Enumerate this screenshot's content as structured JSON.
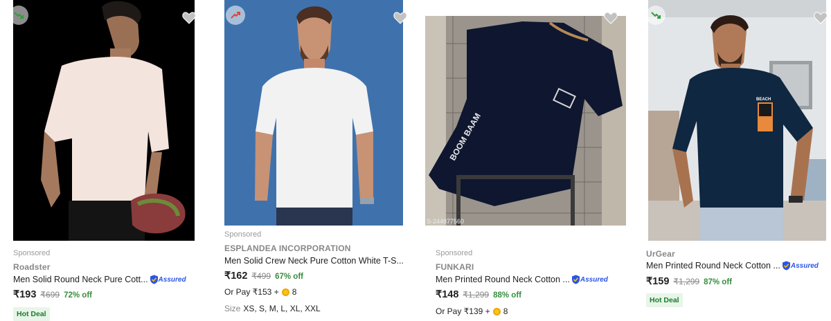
{
  "products": [
    {
      "sponsored": "Sponsored",
      "brand": "Roadster",
      "title": "Men Solid Round Neck Pure Cott...",
      "assured": "Assured",
      "price": "₹193",
      "mrp": "₹699",
      "off": "72% off",
      "badge": "Hot Deal",
      "trend_icon": "trend-down-icon"
    },
    {
      "sponsored": "Sponsored",
      "brand": "ESPLANDEA INCORPORATION",
      "title": "Men Solid Crew Neck Pure Cotton White T-S...",
      "price": "₹162",
      "mrp": "₹499",
      "off": "67% off",
      "pay_prefix": "Or Pay ₹153 +",
      "pay_coins": "8",
      "size_label": "Size",
      "sizes": "XS, S, M, L, XL, XXL",
      "trend_icon": "trend-up-icon"
    },
    {
      "sponsored": "Sponsored",
      "brand": "FUNKARI",
      "title": "Men Printed Round Neck Cotton ...",
      "assured": "Assured",
      "price": "₹148",
      "mrp": "₹1,299",
      "off": "88% off",
      "pay_prefix": "Or Pay ₹139 +",
      "pay_coins": "8",
      "image_text": "BOOM BAAM",
      "image_code": "S-244877560"
    },
    {
      "brand": "UrGear",
      "title": "Men Printed Round Neck Cotton ...",
      "assured": "Assured",
      "price": "₹159",
      "mrp": "₹1,299",
      "off": "87% off",
      "badge": "Hot Deal",
      "image_text": "BEACH",
      "trend_icon": "trend-down-icon"
    }
  ],
  "colors": {
    "discount": "#388e3c",
    "assured": "#2a55e5",
    "hot_deal_bg": "#e8f5e9"
  }
}
